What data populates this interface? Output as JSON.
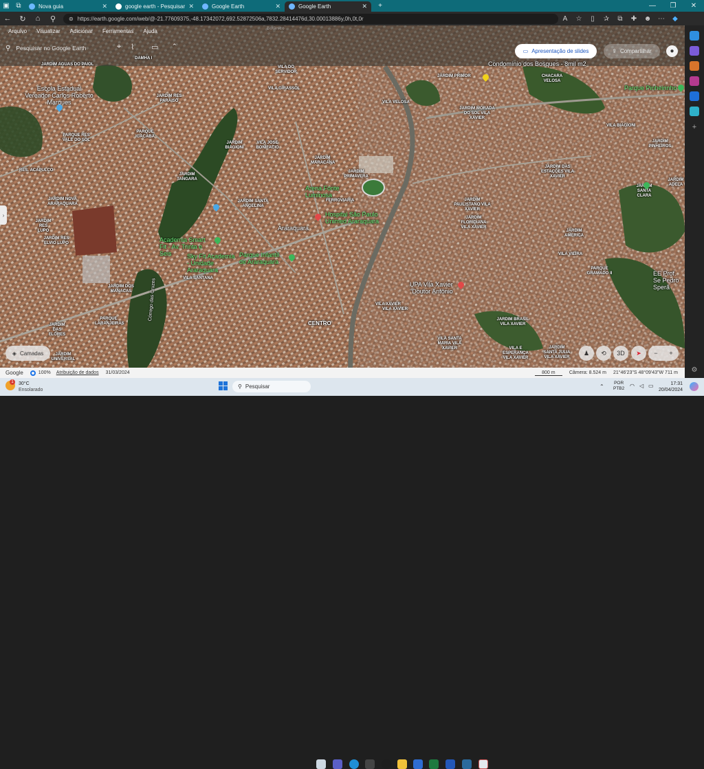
{
  "browser": {
    "tabs": [
      {
        "label": "Nova guia",
        "favicon_color": "#6bb8ff"
      },
      {
        "label": "google earth - Pesquisar",
        "favicon_color": "#ffffff"
      },
      {
        "label": "Google Earth",
        "favicon_color": "#6fb6ff"
      },
      {
        "label": "Google Earth",
        "favicon_color": "#6fb6ff"
      }
    ],
    "new_tab": "+",
    "url": "https://earth.google.com/web/@-21.77609375,-48.17342072,692.52872506a,7832.28414476d,30.00013886y,0h,0t,0r",
    "window_buttons": [
      "—",
      "❐",
      "✕"
    ]
  },
  "earth": {
    "menu": [
      "Arquivo",
      "Visualizar",
      "Adicionar",
      "Ferramentas",
      "Ajuda"
    ],
    "search_placeholder": "Pesquisar no Google Earth",
    "slides_label": "Apresentação de slides",
    "share_label": "Compartilhar",
    "layers_label": "Camadas",
    "controls": {
      "threed": "3D",
      "zoom_out": "−",
      "zoom_in": "+"
    },
    "status": {
      "google": "Google",
      "percent": "100%",
      "attribution": "Atribuição de dados",
      "date": "31/03/2024",
      "scale": "800 m",
      "camera": "Câmera: 8.524 m",
      "coords": "21°46'23\"S 48°09'43\"W  711 m"
    }
  },
  "map_labels": {
    "neighborhoods": [
      "JARDIM AGUAS DO PAIOL",
      "DAMHA I",
      "JARDIM RES PARAISO",
      "VILA DO SERVIDOR",
      "VILA GIRASSOL",
      "JARDIM PRIMOR",
      "CHACARA VELOSA",
      "VILA VELOSA",
      "JARDIM MORADA DO SOL VILA XAVIER",
      "PARQUE RES VALE DO SOL",
      "PARQUE IGACABA",
      "JARDIM BIAGIONI",
      "VILA JOSE BONIFACIO",
      "VILA BIAGIONI",
      "JARDIM PINHEIROS",
      "RES. ACAPULCO",
      "JARDIM TANGARA",
      "JARDIM MARACANA",
      "JARDIM PRIMAVERA",
      "JARDIM DAS ESTAÇÕES VILA XAVIER",
      "JARDIM ADELA",
      "JARDIM SANTA CLARA",
      "JARDIM NOVA ARARAQUARA",
      "JARDIM SANTA ANGELINA",
      "FERROVIARIA",
      "JARDIM PAULISTANO VILA XAVIER",
      "JARDIM RES LUPO",
      "JARDIM RES ELVIO LUPO",
      "JARDIM FLORIDIANA VILA XAVIER",
      "JARDIM AMERICA",
      "VILA VIEIRA",
      "VILA SANTANA",
      "PARQUE GRAMADO II",
      "JARDIM DOS MANACAS",
      "VILA XAVIER",
      "VILA XAVIER",
      "CENTRO",
      "JARDIM DAS FLORES",
      "PARQUE LARANJEIRAS",
      "JARDIM BRASIL VILA XAVIER",
      "VILA SANTA MARIA VILA XAVIER",
      "JARDIM UNIVERSAL",
      "VILA E ESPERANÇA VILA XAVIER",
      "JARDIM SANTA JULIA VILA XAVIER"
    ],
    "places": [
      "Condomínio dos Bosques - 8mil m2",
      "Escola Estadual Vereador Carlos Roberto Marques",
      "Arena Fonte Luminosa",
      "Araraquara",
      "Hospital São Paulo Unimed Araraquara",
      "UPA Vila Xavier \"Doutor Antônio",
      "EE Prof. Se Pedro Sperã",
      "Córrego das Cruzes",
      "Botânico"
    ],
    "green_places": [
      "Parque Pinheirinho",
      "Academia Smart Fit - Av. Trinta e Seis",
      "Sky Fit Academia - Unidade Araraquara",
      "Parque Infantil de Araraquara"
    ]
  },
  "taskbar": {
    "weather_temp": "30°C",
    "weather_desc": "Ensolarado",
    "search": "Pesquisar",
    "lang1": "POR",
    "lang2": "PTB2",
    "time": "17:31",
    "date": "20/04/2024",
    "badge": "1"
  }
}
